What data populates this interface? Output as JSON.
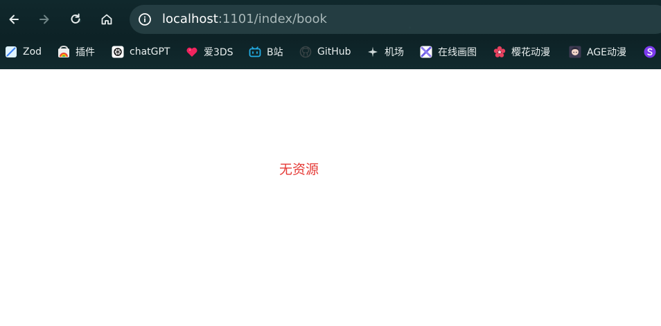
{
  "browser": {
    "address": {
      "host": "localhost",
      "rest": ":1101/index/book"
    },
    "bookmarks": [
      {
        "label": "Zod",
        "icon": "zod-icon"
      },
      {
        "label": "插件",
        "icon": "chrome-webstore-icon"
      },
      {
        "label": "chatGPT",
        "icon": "openai-icon"
      },
      {
        "label": "爱3DS",
        "icon": "heart-icon"
      },
      {
        "label": "B站",
        "icon": "bilibili-icon"
      },
      {
        "label": "GitHub",
        "icon": "github-icon"
      },
      {
        "label": "机场",
        "icon": "plane-icon"
      },
      {
        "label": "在线画图",
        "icon": "drawing-app-icon"
      },
      {
        "label": "樱花动漫",
        "icon": "sakura-icon"
      },
      {
        "label": "AGE动漫",
        "icon": "anime-avatar-icon"
      },
      {
        "label": "",
        "icon": "purple-s-icon"
      }
    ]
  },
  "page": {
    "empty_message": "无资源"
  },
  "colors": {
    "chrome_bg": "#10282c",
    "address_bg": "#284246",
    "empty_text": "#e53935"
  }
}
